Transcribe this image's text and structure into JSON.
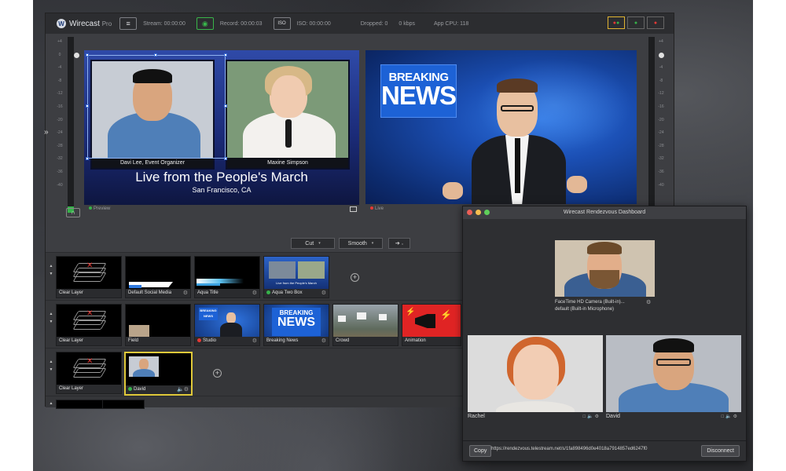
{
  "colors": {
    "app_bg": "#3d3e42",
    "titlebar_bg": "#2c2d30",
    "accent_green": "#36b24a",
    "live_red": "#e53935",
    "selected_yellow": "#e0c93a",
    "breaking_blue": "#1d62d6"
  },
  "app": {
    "logo_letter": "W",
    "name": "Wirecast",
    "edition": "Pro",
    "stats": {
      "stream": "Stream: 00:00:00",
      "record": "Record: 00:00:03",
      "iso": "ISO: 00:00:00",
      "dropped": "Dropped: 0",
      "kbps": "0 kbps",
      "cpu": "App CPU: 118"
    },
    "icons": [
      "wifi-broadcast-icon",
      "record-icon",
      "iso-icon",
      "expand-chevron-icon",
      "headphones-icon",
      "monitor-icon"
    ],
    "iso_label": "ISO"
  },
  "vu_scale": [
    "+4",
    "0",
    "-4",
    "-8",
    "-12",
    "-16",
    "-20",
    "-24",
    "-28",
    "-32",
    "-36",
    "-40"
  ],
  "preview": {
    "person1_caption": "Davi Lee, Event Organizer",
    "person2_caption": "Maxine Simpson",
    "title": "Live from the People's March",
    "subtitle": "San Francisco, CA",
    "label": "Preview"
  },
  "live": {
    "graphic_line1": "BREAKING",
    "graphic_line2": "NEWS",
    "label": "Live"
  },
  "transition": {
    "cut_label": "Cut",
    "smooth_label": "Smooth",
    "go_label": "➔"
  },
  "layers": [
    {
      "shots": [
        {
          "label": "Clear Layer"
        },
        {
          "label": "Default Social Media"
        },
        {
          "label": "Aqua Title"
        },
        {
          "label": "Aqua Two Box",
          "status": "live"
        }
      ]
    },
    {
      "shots": [
        {
          "label": "Clear Layer"
        },
        {
          "label": "Field"
        },
        {
          "label": "Studio",
          "status": "live"
        },
        {
          "label": "Breaking News"
        },
        {
          "label": "Crowd"
        },
        {
          "label": "Animation"
        }
      ]
    },
    {
      "shots": [
        {
          "label": "Clear Layer"
        },
        {
          "label": "David",
          "status": "preview"
        }
      ]
    }
  ],
  "thumb_text": {
    "two_box_title": "Live from the People's March",
    "breaking": "BREAKING",
    "news": "NEWS"
  },
  "rendezvous": {
    "title": "Wirecast Rendezvous Dashboard",
    "host_caption_line1": "FaceTime HD Camera (Built-in)...",
    "host_caption_line2": "default (Built-in Microphone)",
    "guests": [
      "Rachel",
      "David"
    ],
    "copy_label": "Copy",
    "url": "https://rendezvous.telestream.net/s/1fa898496d0e4018a7914857ed6247f0",
    "disconnect_label": "Disconnect"
  }
}
